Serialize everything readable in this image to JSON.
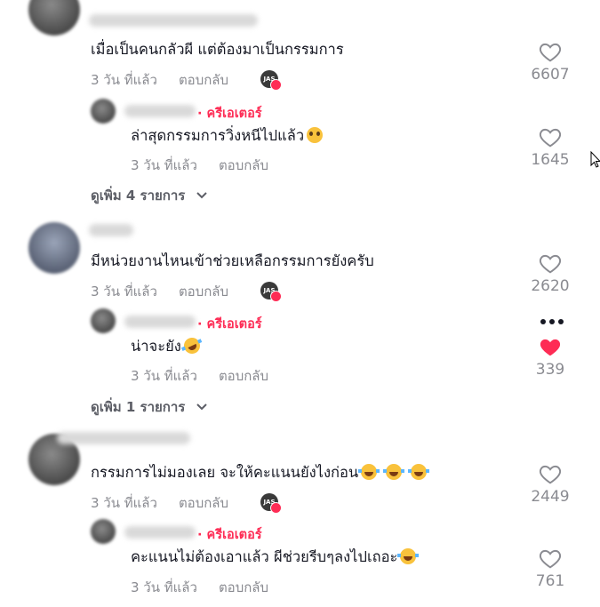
{
  "threads": [
    {
      "comment": "เมื่อเป็นคนกลัวผี แต่ต้องมาเป็นกรรมการ",
      "time": "3 วัน ที่แล้ว",
      "reply_label": "ตอบกลับ",
      "likes": "6607",
      "reply": {
        "creator_label": "· ครีเอเตอร์",
        "text": "ล่าสุดกรรมการวิ่งหนีไปแล้ว",
        "time": "3 วัน ที่แล้ว",
        "reply_label": "ตอบกลับ",
        "likes": "1645"
      },
      "more_label": "ดูเพิ่ม 4 รายการ"
    },
    {
      "comment": "มีหน่วยงานไหนเข้าช่วยเหลือกรรมการยังครับ",
      "time": "3 วัน ที่แล้ว",
      "reply_label": "ตอบกลับ",
      "likes": "2620",
      "reply": {
        "creator_label": "· ครีเอเตอร์",
        "text": "น่าจะยัง",
        "time": "3 วัน ที่แล้ว",
        "reply_label": "ตอบกลับ",
        "likes": "339",
        "liked": true
      },
      "more_label": "ดูเพิ่ม 1 รายการ"
    },
    {
      "comment": "กรรมการไม่มองเลย จะให้คะแนนยังไงก่อน",
      "time": "3 วัน ที่แล้ว",
      "reply_label": "ตอบกลับ",
      "likes": "2449",
      "reply": {
        "creator_label": "· ครีเอเตอร์",
        "text": "คะแนนไม่ต้องเอาแล้ว ผีช่วยรีบๆลงไปเถอะ",
        "time": "3 วัน ที่แล้ว",
        "reply_label": "ตอบกลับ",
        "likes": "761"
      }
    }
  ],
  "colors": {
    "accent": "#fe2c55",
    "muted": "#8a8b91",
    "text": "#161823"
  },
  "icons": [
    "heart-outline-icon",
    "heart-filled-icon",
    "chevron-down-icon",
    "more-dots-icon",
    "cursor-icon",
    "creator-badge-icon"
  ]
}
